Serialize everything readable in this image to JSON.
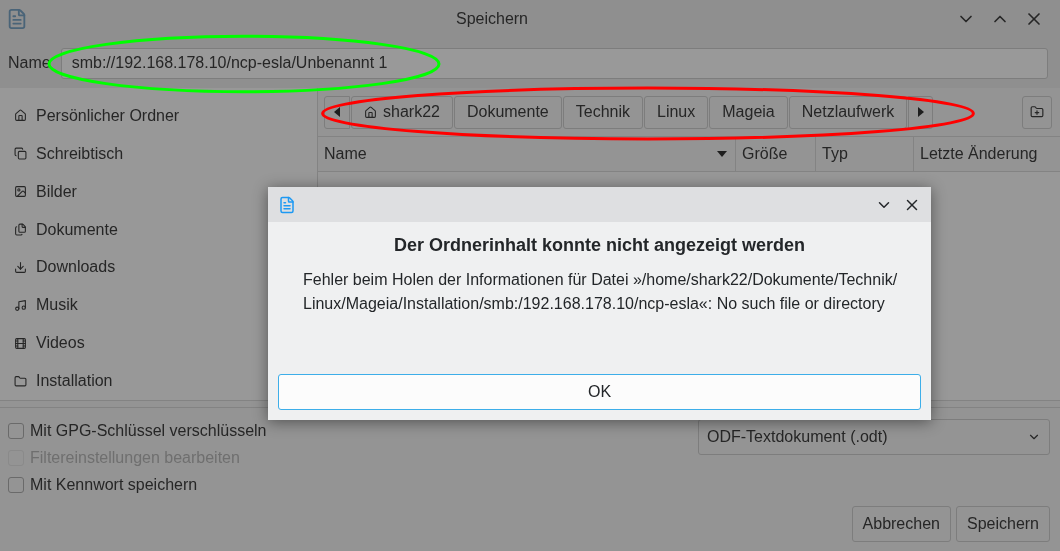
{
  "window": {
    "title": "Speichern"
  },
  "name_field": {
    "label": "Name",
    "value": "smb://192.168.178.10/ncp-esla/Unbenannt 1"
  },
  "sidebar": {
    "items": [
      {
        "label": "Persönlicher Ordner",
        "kind": "home"
      },
      {
        "label": "Schreibtisch",
        "kind": "desktop"
      },
      {
        "label": "Bilder",
        "kind": "pictures"
      },
      {
        "label": "Dokumente",
        "kind": "documents"
      },
      {
        "label": "Downloads",
        "kind": "downloads"
      },
      {
        "label": "Musik",
        "kind": "music"
      },
      {
        "label": "Videos",
        "kind": "videos"
      },
      {
        "label": "Installation",
        "kind": "folder"
      }
    ]
  },
  "breadcrumb": {
    "items": [
      {
        "label": "shark22",
        "kind": "home"
      },
      {
        "label": "Dokumente",
        "kind": "folder"
      },
      {
        "label": "Technik",
        "kind": "folder"
      },
      {
        "label": "Linux",
        "kind": "folder"
      },
      {
        "label": "Mageia",
        "kind": "folder"
      },
      {
        "label": "Netzlaufwerk",
        "kind": "folder"
      }
    ]
  },
  "columns": [
    {
      "label": "Name",
      "sorted": true
    },
    {
      "label": "Größe",
      "sorted": false
    },
    {
      "label": "Typ",
      "sorted": false
    },
    {
      "label": "Letzte Änderung",
      "sorted": false
    }
  ],
  "options": [
    {
      "label": "Mit GPG-Schlüssel verschlüsseln",
      "checked": false,
      "disabled": false
    },
    {
      "label": "Filtereinstellungen bearbeiten",
      "checked": false,
      "disabled": true
    },
    {
      "label": "Mit Kennwort speichern",
      "checked": false,
      "disabled": false
    }
  ],
  "filter": {
    "value": "ODF-Textdokument (.odt)"
  },
  "buttons": [
    "Abbrechen",
    "Speichern"
  ],
  "dialog": {
    "heading": "Der Ordnerinhalt konnte nicht angezeigt werden",
    "message": "Fehler beim Holen der Informationen für Datei »/home/shark22/Dokumente/Technik/Linux/Mageia/Installation/smb:/192.168.178.10/ncp-esla«: No such file or directory",
    "button": "OK"
  },
  "annotations": [
    {
      "color": "#00ff00"
    },
    {
      "color": "#ff0000"
    }
  ]
}
